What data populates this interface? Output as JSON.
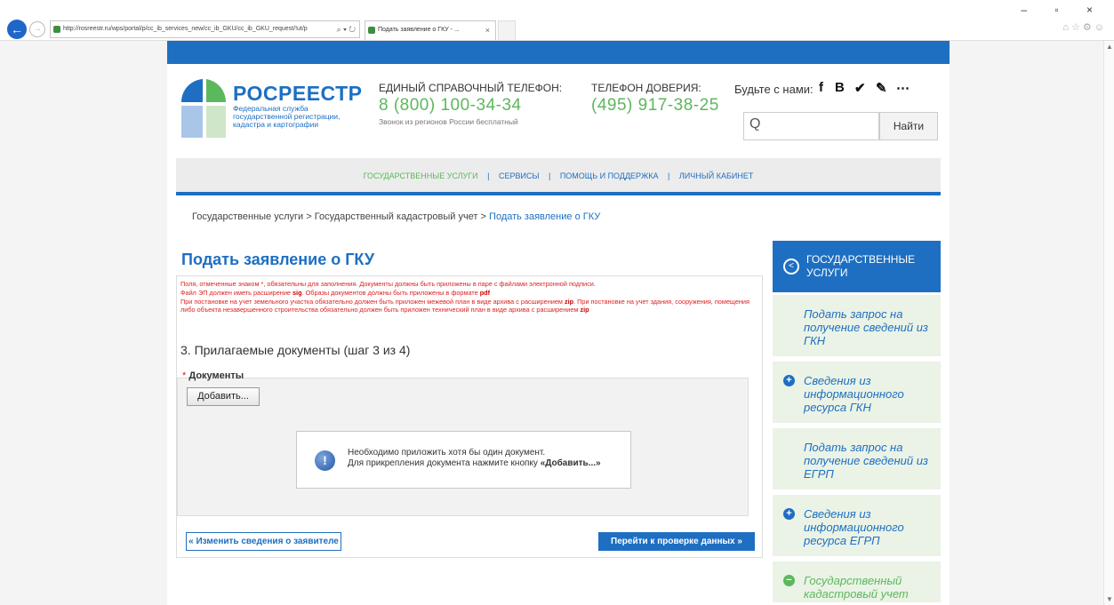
{
  "browser": {
    "back_glyph": "←",
    "forward_glyph": "→",
    "url": "http://rosreestr.ru/wps/portal/p/cc_ib_services_new/cc_ib_GKU/cc_ib_GKU_request/!ut/p",
    "address_tools": "⌕ ▾ ↻",
    "tab_title": "Подать заявление о ГКУ - ...",
    "tab_close": "×",
    "window_controls": "– ▫ ×",
    "right_icons": "⌂☆⚙☺"
  },
  "header": {
    "logo_title": "РОСРЕЕСТР",
    "logo_subtitle": "Федеральная служба государственной регистрации, кадастра и картографии",
    "phone_label": "ЕДИНЫЙ СПРАВОЧНЫЙ ТЕЛЕФОН:",
    "phone_number": "8 (800) 100-34-34",
    "phone_note": "Звонок из регионов России бесплатный",
    "trust_label": "ТЕЛЕФОН ДОВЕРИЯ:",
    "trust_number": "(495) 917-38-25",
    "social_label": "Будьте с нами:",
    "social_icons": [
      "f",
      "B",
      "✔",
      "✎",
      "⋯"
    ],
    "search_icon": "Q",
    "search_button": "Найти"
  },
  "menu": {
    "items": [
      "ГОСУДАРСТВЕННЫЕ УСЛУГИ",
      "СЕРВИСЫ",
      "ПОМОЩЬ И ПОДДЕРЖКА",
      "ЛИЧНЫЙ КАБИНЕТ"
    ],
    "separator": "|"
  },
  "breadcrumb": {
    "items": [
      "Государственные услуги",
      "Государственный кадастровый учет",
      "Подать заявление о ГКУ"
    ],
    "separator": ">"
  },
  "form": {
    "title": "Подать заявление о ГКУ",
    "note1": "Поля, отмеченные знаком *, обязательны для заполнения. Документы должны быть приложены в паре с файлами электронной подписи.",
    "note2_a": "Файл ЭП должен иметь расширение ",
    "note2_b": "sig",
    "note2_c": ". Образы документов должны быть приложены в формате ",
    "note2_d": "pdf",
    "note3_a": "При постановке на учет земельного участка обязательно должен быть приложен межевой план в виде архива с расширением ",
    "note3_b": "zip",
    "note3_c": ". При постановке на учет здания, сооружения, помещения либо объекта незавершенного строительства обязательно должен быть приложен технический план в виде архива с расширением ",
    "note3_d": "zip",
    "step": "3. Прилагаемые документы (шаг 3 из 4)",
    "docs_required_mark": "*",
    "docs_label": "Документы",
    "add_button": "Добавить...",
    "notice_icon": "!",
    "notice_line1": "Необходимо приложить хотя бы один документ.",
    "notice_line2_a": "Для прикрепления документа нажмите кнопку ",
    "notice_line2_b": "«Добавить...»",
    "back_button": "« Изменить сведения о заявителе",
    "next_button": "Перейти к проверке данных »"
  },
  "sidebar": {
    "head_icon": "<",
    "head": "ГОСУДАРСТВЕННЫЕ УСЛУГИ",
    "items": [
      {
        "label": "Подать запрос на получение сведений из ГКН",
        "icon": ""
      },
      {
        "label": "Сведения из информационного ресурса ГКН",
        "icon": "+"
      },
      {
        "label": "Подать запрос на получение сведений из ЕГРП",
        "icon": ""
      },
      {
        "label": "Сведения из информационного ресурса ЕГРП",
        "icon": "+"
      },
      {
        "label": "Государственный кадастровый учет",
        "icon": "−"
      }
    ]
  },
  "colors": {
    "brand_blue": "#1e6fc2",
    "brand_green": "#5cb85c",
    "warning_red": "#e02020"
  }
}
